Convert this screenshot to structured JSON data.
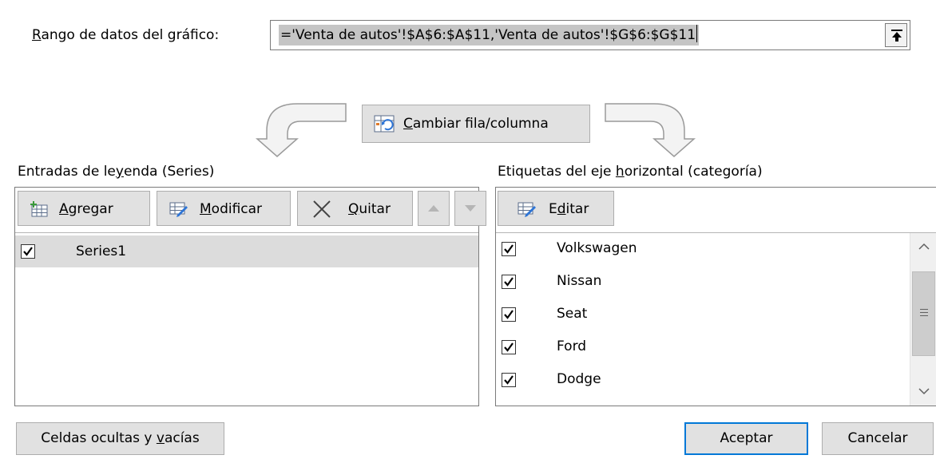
{
  "range": {
    "label_mnemonic": "R",
    "label_rest": "ango de datos del gráfico:",
    "value": "='Venta de autos'!$A$6:$A$11,'Venta de autos'!$G$6:$G$11",
    "collapse_icon": "collapse-dialog-icon"
  },
  "switch": {
    "mnemonic": "C",
    "rest": "ambiar fila/columna",
    "icon": "switch-row-column-icon"
  },
  "series": {
    "header_pre": "Entradas de le",
    "header_mnemonic": "y",
    "header_post": "enda (Series)",
    "add": {
      "mnemonic": "A",
      "rest": "gregar"
    },
    "edit": {
      "mnemonic": "M",
      "rest": "odificar"
    },
    "remove": {
      "mnemonic": "Q",
      "rest": "uitar"
    },
    "items": [
      {
        "label": "Series1",
        "checked": true
      }
    ]
  },
  "axis": {
    "header_pre": "Etiquetas del eje ",
    "header_mnemonic": "h",
    "header_post": "orizontal (categoría)",
    "edit": {
      "pre": "E",
      "mnemonic": "d",
      "post": "itar"
    },
    "items": [
      {
        "label": "Volkswagen",
        "checked": true
      },
      {
        "label": "Nissan",
        "checked": true
      },
      {
        "label": "Seat",
        "checked": true
      },
      {
        "label": "Ford",
        "checked": true
      },
      {
        "label": "Dodge",
        "checked": true
      }
    ]
  },
  "buttons": {
    "hidden_pre": "Celdas ocultas y ",
    "hidden_mnemonic": "v",
    "hidden_post": "acías",
    "ok": "Aceptar",
    "cancel": "Cancelar"
  },
  "colors": {
    "focus_border": "#0078d7",
    "selection": "#dcdcdc",
    "button_face": "#e1e1e1"
  }
}
